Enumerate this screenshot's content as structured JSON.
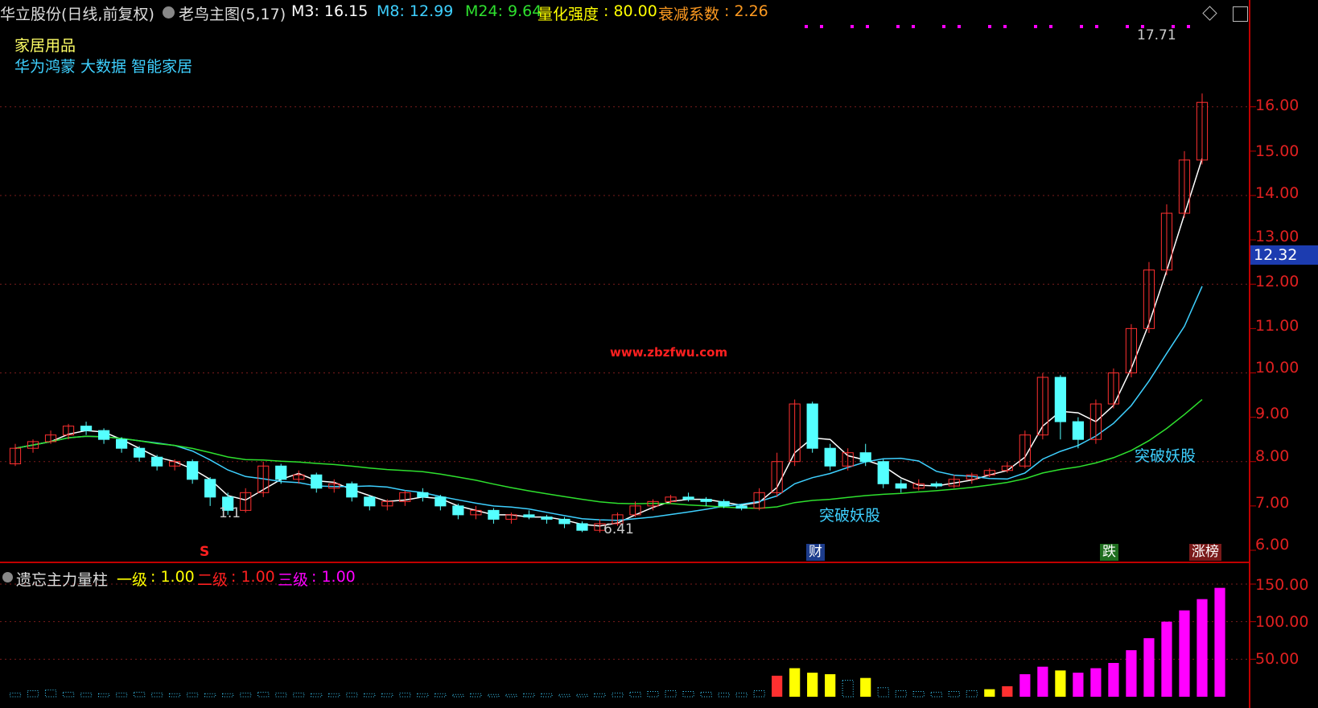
{
  "header": {
    "stock_title": "华立股份(日线,前复权)",
    "indicator_name": "老鸟主图(5,17)",
    "m3": "M3: 16.15",
    "m8": "M8: 12.99",
    "m24": "M24: 9.64",
    "quant_label": "量化强度",
    "quant_value": ": 80.00",
    "decay_label": "衰减系数",
    "decay_value": ": 2.26"
  },
  "concepts": {
    "industry": "家居用品",
    "tags": "华为鸿蒙 大数据 智能家居"
  },
  "watermark": "www.zbzfwu.com",
  "chart_labels": {
    "high_note": "17.71",
    "low_note": "6.41",
    "early_low": "1.1",
    "text_mid": "突破妖股",
    "text_right": "突破妖股"
  },
  "markers": {
    "s_mark": "S",
    "cai": "财",
    "die": "跌",
    "zhangbang": "涨榜"
  },
  "price_axis": {
    "ticks": [
      "16.00",
      "15.00",
      "14.00",
      "13.00",
      "12.00",
      "11.00",
      "10.00",
      "9.00",
      "8.00",
      "7.00",
      "6.00"
    ],
    "current": "12.32"
  },
  "volume_panel": {
    "title": "遗忘主力量柱",
    "level1_label": "一级",
    "level1_value": ": 1.00",
    "level2_label": "二级",
    "level2_value": ": 1.00",
    "level3_label": "三级",
    "level3_value": ": 1.00",
    "ticks": [
      "150.00",
      "100.00",
      "50.00"
    ]
  },
  "colors": {
    "up": "#ff3030",
    "down": "#54ffff",
    "ma_white": "#ffffff",
    "ma_cyan": "#3ed0ff",
    "ma_green": "#2ee02e",
    "yellow": "#ffff00",
    "magenta": "#ff00ff",
    "axis": "#c00000"
  },
  "chart_data": {
    "type": "candlestick",
    "ylim": [
      5.8,
      17.9
    ],
    "candles": [
      [
        7.95,
        8.3,
        7.9,
        8.4
      ],
      [
        8.3,
        8.45,
        8.2,
        8.5
      ],
      [
        8.45,
        8.6,
        8.4,
        8.7
      ],
      [
        8.6,
        8.8,
        8.5,
        8.85
      ],
      [
        8.8,
        8.7,
        8.6,
        8.9
      ],
      [
        8.7,
        8.5,
        8.4,
        8.75
      ],
      [
        8.5,
        8.3,
        8.2,
        8.55
      ],
      [
        8.3,
        8.1,
        8.0,
        8.35
      ],
      [
        8.1,
        7.9,
        7.8,
        8.15
      ],
      [
        7.9,
        8.0,
        7.8,
        8.05
      ],
      [
        8.0,
        7.6,
        7.5,
        8.05
      ],
      [
        7.6,
        7.2,
        7.0,
        7.65
      ],
      [
        7.2,
        6.9,
        6.8,
        7.3
      ],
      [
        6.9,
        7.3,
        6.85,
        7.4
      ],
      [
        7.3,
        7.9,
        7.2,
        8.0
      ],
      [
        7.9,
        7.6,
        7.5,
        7.95
      ],
      [
        7.6,
        7.7,
        7.5,
        7.8
      ],
      [
        7.7,
        7.4,
        7.3,
        7.75
      ],
      [
        7.4,
        7.5,
        7.3,
        7.6
      ],
      [
        7.5,
        7.2,
        7.1,
        7.55
      ],
      [
        7.2,
        7.0,
        6.9,
        7.25
      ],
      [
        7.0,
        7.1,
        6.9,
        7.15
      ],
      [
        7.1,
        7.3,
        7.0,
        7.35
      ],
      [
        7.3,
        7.2,
        7.1,
        7.4
      ],
      [
        7.2,
        7.0,
        6.9,
        7.25
      ],
      [
        7.0,
        6.8,
        6.7,
        7.05
      ],
      [
        6.8,
        6.9,
        6.7,
        7.0
      ],
      [
        6.9,
        6.7,
        6.6,
        6.95
      ],
      [
        6.7,
        6.8,
        6.6,
        6.85
      ],
      [
        6.8,
        6.75,
        6.7,
        6.9
      ],
      [
        6.75,
        6.7,
        6.6,
        6.8
      ],
      [
        6.7,
        6.6,
        6.5,
        6.75
      ],
      [
        6.6,
        6.45,
        6.41,
        6.65
      ],
      [
        6.45,
        6.6,
        6.4,
        6.7
      ],
      [
        6.6,
        6.8,
        6.55,
        6.85
      ],
      [
        6.8,
        7.0,
        6.75,
        7.1
      ],
      [
        7.0,
        7.1,
        6.9,
        7.15
      ],
      [
        7.1,
        7.2,
        7.05,
        7.25
      ],
      [
        7.2,
        7.15,
        7.1,
        7.3
      ],
      [
        7.15,
        7.1,
        7.0,
        7.2
      ],
      [
        7.1,
        7.0,
        6.95,
        7.15
      ],
      [
        7.0,
        6.95,
        6.9,
        7.05
      ],
      [
        6.95,
        7.3,
        6.9,
        7.4
      ],
      [
        7.3,
        8.0,
        7.2,
        8.2
      ],
      [
        8.0,
        9.3,
        7.9,
        9.4
      ],
      [
        9.3,
        8.3,
        8.2,
        9.35
      ],
      [
        8.3,
        7.9,
        7.8,
        8.4
      ],
      [
        7.9,
        8.2,
        7.8,
        8.3
      ],
      [
        8.2,
        8.0,
        7.9,
        8.4
      ],
      [
        8.0,
        7.5,
        7.4,
        8.05
      ],
      [
        7.5,
        7.4,
        7.3,
        7.6
      ],
      [
        7.4,
        7.5,
        7.35,
        7.6
      ],
      [
        7.5,
        7.45,
        7.4,
        7.55
      ],
      [
        7.45,
        7.6,
        7.4,
        7.7
      ],
      [
        7.6,
        7.7,
        7.5,
        7.75
      ],
      [
        7.7,
        7.8,
        7.65,
        7.85
      ],
      [
        7.8,
        7.9,
        7.75,
        8.0
      ],
      [
        7.9,
        8.6,
        7.85,
        8.7
      ],
      [
        8.6,
        9.9,
        8.5,
        10.0
      ],
      [
        9.9,
        8.9,
        8.5,
        9.95
      ],
      [
        8.9,
        8.5,
        8.3,
        9.0
      ],
      [
        8.5,
        9.3,
        8.4,
        9.4
      ],
      [
        9.3,
        10.0,
        9.2,
        10.1
      ],
      [
        10.0,
        11.0,
        9.9,
        11.1
      ],
      [
        11.0,
        12.32,
        10.9,
        12.5
      ],
      [
        12.32,
        13.6,
        12.2,
        13.8
      ],
      [
        13.6,
        14.8,
        13.5,
        15.0
      ],
      [
        14.8,
        16.1,
        14.7,
        16.3
      ]
    ],
    "volume": [
      [
        5,
        "c"
      ],
      [
        8,
        "c"
      ],
      [
        9,
        "c"
      ],
      [
        6,
        "c"
      ],
      [
        5,
        "c"
      ],
      [
        4,
        "c"
      ],
      [
        5,
        "c"
      ],
      [
        6,
        "c"
      ],
      [
        5,
        "c"
      ],
      [
        4,
        "c"
      ],
      [
        5,
        "c"
      ],
      [
        4,
        "c"
      ],
      [
        4,
        "c"
      ],
      [
        5,
        "c"
      ],
      [
        6,
        "c"
      ],
      [
        5,
        "c"
      ],
      [
        5,
        "c"
      ],
      [
        4,
        "c"
      ],
      [
        4,
        "c"
      ],
      [
        5,
        "c"
      ],
      [
        4,
        "c"
      ],
      [
        4,
        "c"
      ],
      [
        5,
        "c"
      ],
      [
        4,
        "c"
      ],
      [
        4,
        "c"
      ],
      [
        3,
        "c"
      ],
      [
        4,
        "c"
      ],
      [
        3,
        "c"
      ],
      [
        3,
        "c"
      ],
      [
        4,
        "c"
      ],
      [
        4,
        "c"
      ],
      [
        3,
        "c"
      ],
      [
        3,
        "c"
      ],
      [
        4,
        "c"
      ],
      [
        5,
        "c"
      ],
      [
        6,
        "c"
      ],
      [
        7,
        "c"
      ],
      [
        8,
        "c"
      ],
      [
        7,
        "c"
      ],
      [
        6,
        "c"
      ],
      [
        5,
        "c"
      ],
      [
        5,
        "c"
      ],
      [
        8,
        "c"
      ],
      [
        28,
        "r"
      ],
      [
        38,
        "y"
      ],
      [
        32,
        "y"
      ],
      [
        30,
        "y"
      ],
      [
        22,
        "c"
      ],
      [
        25,
        "y"
      ],
      [
        12,
        "c"
      ],
      [
        8,
        "c"
      ],
      [
        7,
        "c"
      ],
      [
        6,
        "c"
      ],
      [
        7,
        "c"
      ],
      [
        8,
        "c"
      ],
      [
        10,
        "y"
      ],
      [
        14,
        "r"
      ],
      [
        30,
        "m"
      ],
      [
        40,
        "m"
      ],
      [
        35,
        "y"
      ],
      [
        32,
        "m"
      ],
      [
        38,
        "m"
      ],
      [
        45,
        "m"
      ],
      [
        62,
        "m"
      ],
      [
        78,
        "m"
      ],
      [
        100,
        "m"
      ],
      [
        115,
        "m"
      ],
      [
        130,
        "m"
      ],
      [
        145,
        "m"
      ]
    ]
  }
}
